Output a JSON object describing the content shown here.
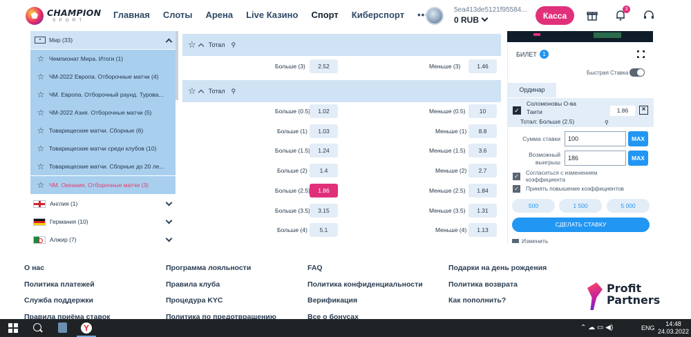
{
  "header": {
    "logo_title": "CHAMPION",
    "logo_sub": "SPORT",
    "nav": [
      "Главная",
      "Слоты",
      "Арена",
      "Live Казино",
      "Спорт",
      "Киберспорт",
      "•••"
    ],
    "account_id": "5ea413de5121f95584...",
    "balance": "0 RUB",
    "kassa": "Касса",
    "notifications_count": "3"
  },
  "sidebar": {
    "world": "Мир (33)",
    "items": [
      "Чемпионат Мира. Итоги (1)",
      "ЧМ-2022 Европа. Отборочные матчи (4)",
      "ЧМ. Европа. Отборочный раунд. Турова...",
      "ЧМ-2022 Азия. Отборочные матчи (5)",
      "Товарищеские матчи. Сборные (6)",
      "Товарищеские матчи среди клубов (10)",
      "Товарищеские матчи. Сборные до 20 ле...",
      "ЧМ. Океания. Отборочные матчи (3)"
    ],
    "countries": [
      "Англия (1)",
      "Германия (10)",
      "Алжир (7)"
    ]
  },
  "markets": {
    "market1_title": "Тотал",
    "market1_rows": [
      {
        "over_label": "Больше (3)",
        "over_odd": "2.52",
        "under_label": "Меньше (3)",
        "under_odd": "1.46"
      }
    ],
    "market2_title": "Тотал",
    "market2_rows": [
      {
        "over_label": "Больше (0.5)",
        "over_odd": "1.02",
        "under_label": "Меньше (0.5)",
        "under_odd": "10"
      },
      {
        "over_label": "Больше (1)",
        "over_odd": "1.03",
        "under_label": "Меньше (1)",
        "under_odd": "8.8"
      },
      {
        "over_label": "Больше (1.5)",
        "over_odd": "1.24",
        "under_label": "Меньше (1.5)",
        "under_odd": "3.6"
      },
      {
        "over_label": "Больше (2)",
        "over_odd": "1.4",
        "under_label": "Меньше (2)",
        "under_odd": "2.7"
      },
      {
        "over_label": "Больше (2.5)",
        "over_odd": "1.86",
        "under_label": "Меньше (2.5)",
        "under_odd": "1.84"
      },
      {
        "over_label": "Больше (3.5)",
        "over_odd": "3.15",
        "under_label": "Меньше (3.5)",
        "under_odd": "1.31"
      },
      {
        "over_label": "Больше (4)",
        "over_odd": "5.1",
        "under_label": "Меньше (4)",
        "under_odd": "1.13"
      }
    ]
  },
  "betslip": {
    "title": "БИЛЕТ",
    "count": "1",
    "quick_bet": "Быстрая Ставка",
    "tab": "Ординар",
    "team1": "Соломоновы О-ва",
    "team2": "Таити",
    "odd": "1.86",
    "market": "Тотал: Больше (2.5)",
    "stake_label": "Сумма ставки",
    "stake_value": "100",
    "win_label_1": "Возможный",
    "win_label_2": "выигрыш",
    "win_value": "186",
    "max": "MAX",
    "agree_1": "Согласиться с изменением",
    "agree_2": "коэффициента",
    "accept_increase": "Принять повышение коэффициентов",
    "quick_amounts": [
      "500",
      "1 500",
      "5 000"
    ],
    "make_bet": "СДЕЛАТЬ СТАВКУ",
    "bottom_text": "Изменить"
  },
  "footer": {
    "col1": [
      "О нас",
      "Политика платежей",
      "Служба поддержки",
      "Правила приёма ставок"
    ],
    "col2": [
      "Программа лояльности",
      "Правила клуба",
      "Процедура KYC",
      "Политика по предотвращению"
    ],
    "col3": [
      "FAQ",
      "Политика конфиденциальности",
      "Верификация",
      "Все о бонусах"
    ],
    "col4": [
      "Подарки на день рождения",
      "Политика возврата",
      "Как пополнить?"
    ],
    "partner_1": "Profit",
    "partner_2": "Partners"
  },
  "taskbar": {
    "lang": "ENG",
    "time": "14:48",
    "date": "24.03.2022"
  },
  "colors": {
    "accent_pink": "#e1307a",
    "accent_blue": "#2196f3",
    "selected_row": "#a9cfef"
  }
}
